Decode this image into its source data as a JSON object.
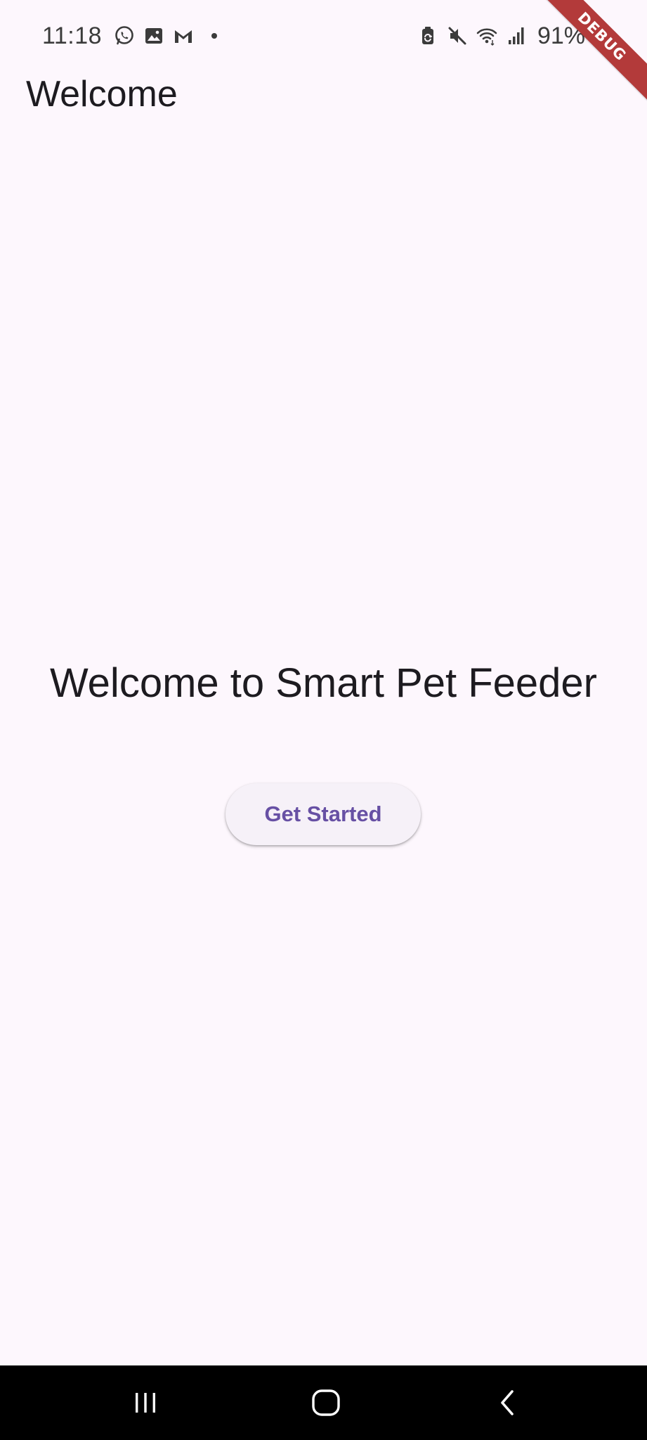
{
  "status_bar": {
    "time": "11:18",
    "left_icons": [
      "whatsapp-icon",
      "image-icon",
      "gmail-icon"
    ],
    "right_icons": [
      "battery-saver-icon",
      "mute-icon",
      "wifi-icon",
      "signal-icon"
    ],
    "battery_percent": "91%"
  },
  "debug_banner": {
    "label": "DEBUG",
    "color": "#B33A3A"
  },
  "app_bar": {
    "title": "Welcome"
  },
  "main": {
    "heading": "Welcome to Smart Pet Feeder",
    "get_started_label": "Get Started"
  },
  "nav_bar": {
    "buttons": [
      "recents-icon",
      "home-icon",
      "back-icon"
    ]
  },
  "colors": {
    "background": "#FDF7FD",
    "primary": "#6750A4",
    "button_surface": "#F6F1F8",
    "text": "#1D1B20"
  }
}
